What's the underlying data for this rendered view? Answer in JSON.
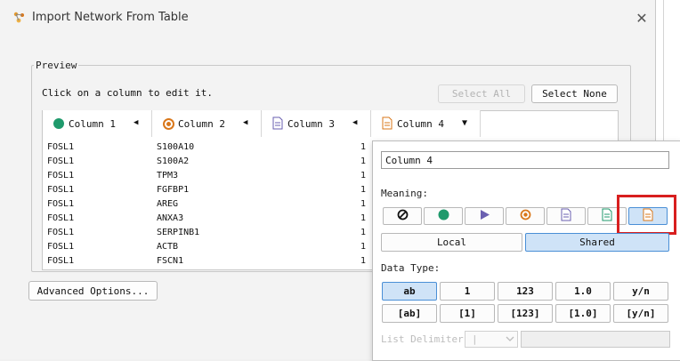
{
  "window": {
    "title": "Import Network From Table"
  },
  "preview": {
    "legend": "Preview",
    "hint": "Click on a column to edit it.",
    "select_all": "Select All",
    "select_none": "Select None"
  },
  "columns": [
    {
      "label": "Column 1",
      "icon": "source-node-icon"
    },
    {
      "label": "Column 2",
      "icon": "target-node-icon"
    },
    {
      "label": "Column 3",
      "icon": "source-attribute-icon"
    },
    {
      "label": "Column 4",
      "icon": "interaction-attribute-icon"
    }
  ],
  "rows": [
    [
      "FOSL1",
      "S100A10",
      "1"
    ],
    [
      "FOSL1",
      "S100A2",
      "1"
    ],
    [
      "FOSL1",
      "TPM3",
      "1"
    ],
    [
      "FOSL1",
      "FGFBP1",
      "1"
    ],
    [
      "FOSL1",
      "AREG",
      "1"
    ],
    [
      "FOSL1",
      "ANXA3",
      "1"
    ],
    [
      "FOSL1",
      "SERPINB1",
      "1"
    ],
    [
      "FOSL1",
      "ACTB",
      "1"
    ],
    [
      "FOSL1",
      "FSCN1",
      "1"
    ]
  ],
  "advanced_options": "Advanced Options...",
  "popup": {
    "column_name": "Column 4",
    "meaning_label": "Meaning:",
    "meaning_buttons": [
      "none-icon",
      "source-node-icon",
      "interaction-icon",
      "target-node-icon",
      "source-attribute-icon",
      "target-attribute-icon",
      "edge-attribute-icon"
    ],
    "local": "Local",
    "shared": "Shared",
    "data_type_label": "Data Type:",
    "data_types": [
      "ab",
      "1",
      "123",
      "1.0",
      "y/n",
      "[ab]",
      "[1]",
      "[123]",
      "[1.0]",
      "[y/n]"
    ],
    "list_delimiter_label": "List Delimiter:",
    "list_delimiter_value": "|"
  }
}
